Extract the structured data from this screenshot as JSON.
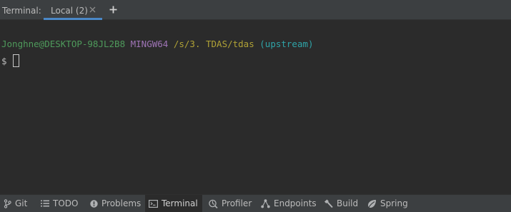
{
  "tool_window": {
    "title": "Terminal:",
    "tabs": [
      {
        "label": "Local (2)",
        "active": true
      }
    ]
  },
  "terminal": {
    "prompt_line": {
      "user_host": "Jonghne@DESKTOP-98JL2B8",
      "system": "MINGW64",
      "path": "/s/3. TDAS/tdas",
      "branch": "(upstream)"
    },
    "input_prompt": "$"
  },
  "bottom_tools": [
    {
      "label": "Git",
      "icon": "git-branch-icon"
    },
    {
      "label": "TODO",
      "icon": "list-icon"
    },
    {
      "label": "Problems",
      "icon": "warning-icon"
    },
    {
      "label": "Terminal",
      "icon": "terminal-icon",
      "active": true
    },
    {
      "label": "Profiler",
      "icon": "profiler-icon"
    },
    {
      "label": "Endpoints",
      "icon": "endpoints-icon"
    },
    {
      "label": "Build",
      "icon": "hammer-icon"
    },
    {
      "label": "Spring",
      "icon": "spring-leaf-icon"
    }
  ],
  "colors": {
    "background": "#2b2b2b",
    "panel": "#3c3f41",
    "user_host": "#4e9a5b",
    "system": "#9f74b6",
    "path": "#b0a236",
    "branch": "#2fa4a8",
    "active_tab_underline": "#4a88c7"
  }
}
